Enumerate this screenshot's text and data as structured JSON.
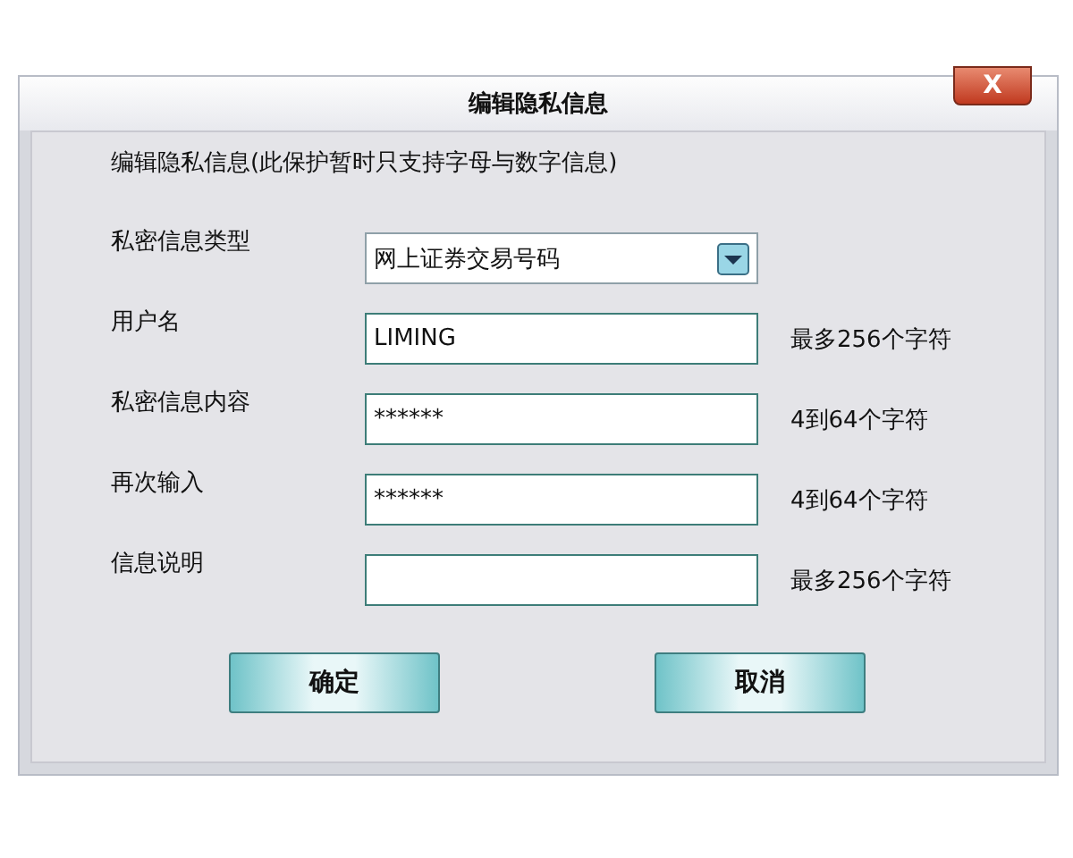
{
  "window": {
    "title": "编辑隐私信息",
    "close": "X"
  },
  "intro": "编辑隐私信息(此保护暂时只支持字母与数字信息)",
  "fields": [
    {
      "kind": "select",
      "label": "私密信息类型",
      "value": "网上证券交易号码"
    },
    {
      "kind": "text",
      "label": "用户名",
      "value": "LIMING",
      "hint": "最多256个字符"
    },
    {
      "kind": "text",
      "label": "私密信息内容",
      "value": "******",
      "hint": "4到64个字符"
    },
    {
      "kind": "text",
      "label": "再次输入",
      "value": "******",
      "hint": "4到64个字符"
    },
    {
      "kind": "text",
      "label": "信息说明",
      "hint": "最多256个字符"
    }
  ],
  "buttons": [
    "确定",
    "取消"
  ]
}
